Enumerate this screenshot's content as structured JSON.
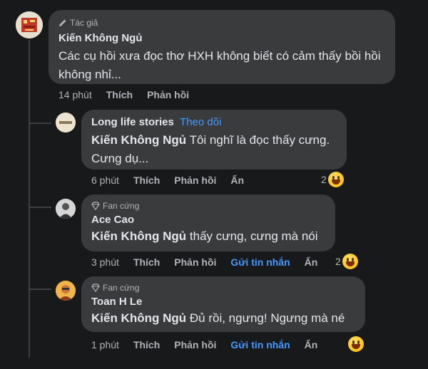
{
  "colors": {
    "background": "#18191a",
    "bubble": "#3a3b3c",
    "link": "#4599ff",
    "muted": "#b0b3b8"
  },
  "main_comment": {
    "badge": "Tác giả",
    "author": "Kiến Không Ngủ",
    "text": "Các cụ hồi xưa đọc thơ HXH không biết có cảm thấy bồi hồi không nhỉ...",
    "time": "14 phút",
    "like": "Thích",
    "reply": "Phản hồi"
  },
  "replies": [
    {
      "author": "Long life stories",
      "follow": "Theo dõi",
      "mention": "Kiến Không Ngủ",
      "text": "Tôi nghĩ là đọc thấy cưng. Cưng dụ...",
      "time": "6 phút",
      "like": "Thích",
      "reply": "Phản hồi",
      "hide": "Ẩn",
      "reaction_count": "2",
      "reaction_icon": "haha-emoji-icon"
    },
    {
      "badge": "Fan cứng",
      "author": "Ace Cao",
      "mention": "Kiến Không Ngủ",
      "text": "thấy cưng, cưng mà nói",
      "time": "3 phút",
      "like": "Thích",
      "reply": "Phản hồi",
      "message": "Gửi tin nhắn",
      "hide": "Ẩn",
      "reaction_count": "2",
      "reaction_icon": "haha-emoji-icon"
    },
    {
      "badge": "Fan cứng",
      "author": "Toan H Le",
      "mention": "Kiến Không Ngủ",
      "text": "Đủ rồi, ngưng! Ngưng mà né",
      "time": "1 phút",
      "like": "Thích",
      "reply": "Phản hồi",
      "message": "Gửi tin nhắn",
      "hide": "Ẩn",
      "reaction_icon": "haha-emoji-icon"
    }
  ]
}
